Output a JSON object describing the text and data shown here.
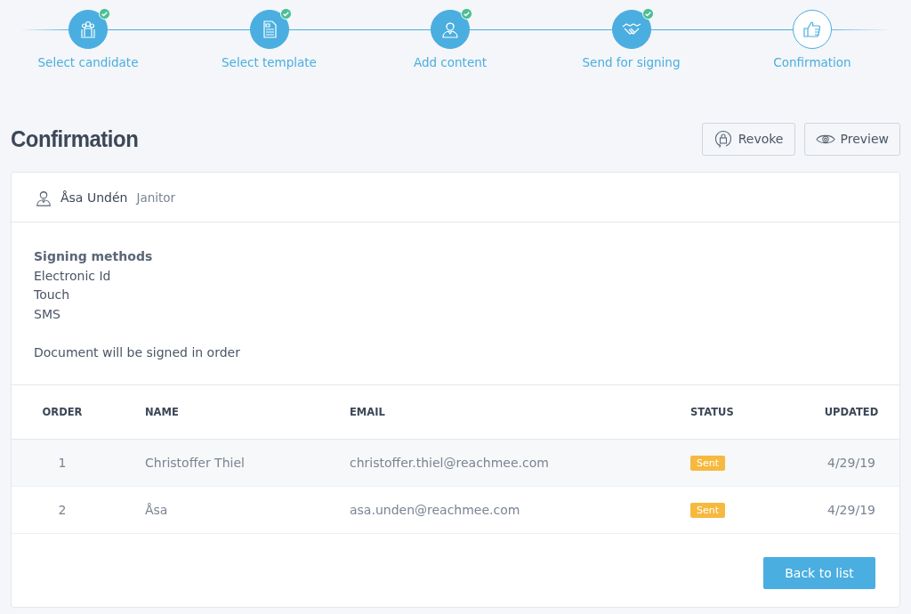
{
  "steps": [
    {
      "label": "Select candidate",
      "kind": "group",
      "done": true,
      "selected": false
    },
    {
      "label": "Select template",
      "kind": "document",
      "done": true,
      "selected": false
    },
    {
      "label": "Add content",
      "kind": "person",
      "done": true,
      "selected": false
    },
    {
      "label": "Send for signing",
      "kind": "handshake",
      "done": true,
      "selected": false
    },
    {
      "label": "Confirmation",
      "kind": "thumbs-up",
      "done": false,
      "selected": true
    }
  ],
  "title": "Confirmation",
  "actions": [
    {
      "label": "Revoke",
      "kind": "lock"
    },
    {
      "label": "Preview",
      "kind": "eye"
    }
  ],
  "candidate": {
    "name": "Åsa Undén",
    "role": "Janitor"
  },
  "signing_methods": {
    "heading": "Signing methods",
    "items": [
      "Electronic Id",
      "Touch",
      "SMS"
    ],
    "note": "Document will be signed in order"
  },
  "table": {
    "columns": [
      "ORDER",
      "NAME",
      "EMAIL",
      "STATUS",
      "UPDATED"
    ],
    "rows": [
      {
        "order": "1",
        "name": "Christoffer Thiel",
        "email": "christoffer.thiel@reachmee.com",
        "status": "Sent",
        "color": "#f6b93f",
        "updated": "4/29/19"
      },
      {
        "order": "2",
        "name": "Åsa",
        "email": "asa.unden@reachmee.com",
        "status": "Sent",
        "color": "#f6b93f",
        "updated": "4/29/19"
      }
    ]
  },
  "back_button": "Back to list"
}
